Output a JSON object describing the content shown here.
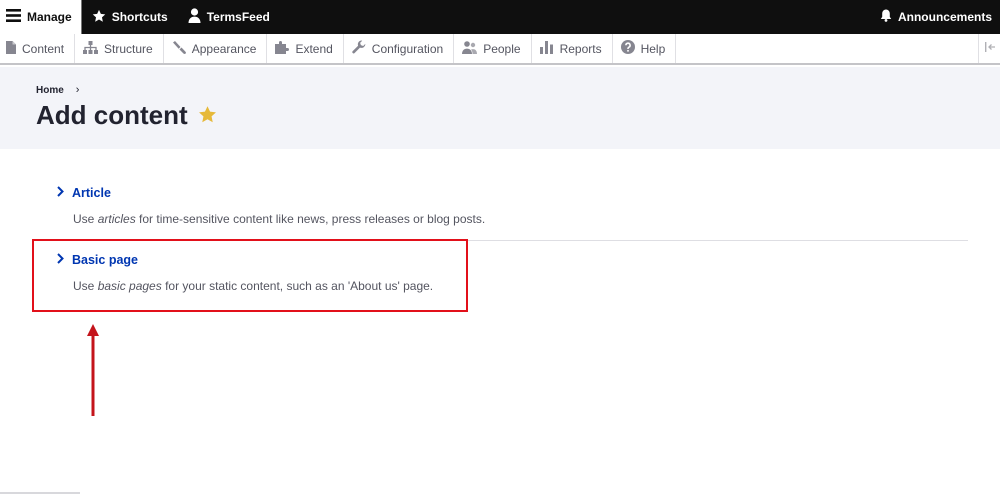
{
  "toolbar": {
    "manage": "Manage",
    "shortcuts": "Shortcuts",
    "user": "TermsFeed",
    "announcements": "Announcements"
  },
  "tray": {
    "items": [
      {
        "label": "Content",
        "icon": "content-icon"
      },
      {
        "label": "Structure",
        "icon": "structure-icon"
      },
      {
        "label": "Appearance",
        "icon": "appearance-icon"
      },
      {
        "label": "Extend",
        "icon": "extend-icon"
      },
      {
        "label": "Configuration",
        "icon": "configuration-icon"
      },
      {
        "label": "People",
        "icon": "people-icon"
      },
      {
        "label": "Reports",
        "icon": "reports-icon"
      },
      {
        "label": "Help",
        "icon": "help-icon"
      }
    ]
  },
  "breadcrumb": {
    "home": "Home",
    "separator": "›"
  },
  "page": {
    "title": "Add content"
  },
  "content_types": [
    {
      "label": "Article",
      "desc_before": "Use ",
      "desc_em": "articles",
      "desc_after": " for time-sensitive content like news, press releases or blog posts."
    },
    {
      "label": "Basic page",
      "desc_before": "Use ",
      "desc_em": "basic pages",
      "desc_after": " for your static content, such as an 'About us' page."
    }
  ],
  "colors": {
    "toolbar_bg": "#0f0f0f",
    "link": "#0036b1",
    "header_bg": "#f3f4f9",
    "annotation": "#e2101a",
    "star": "#e6b93a"
  }
}
